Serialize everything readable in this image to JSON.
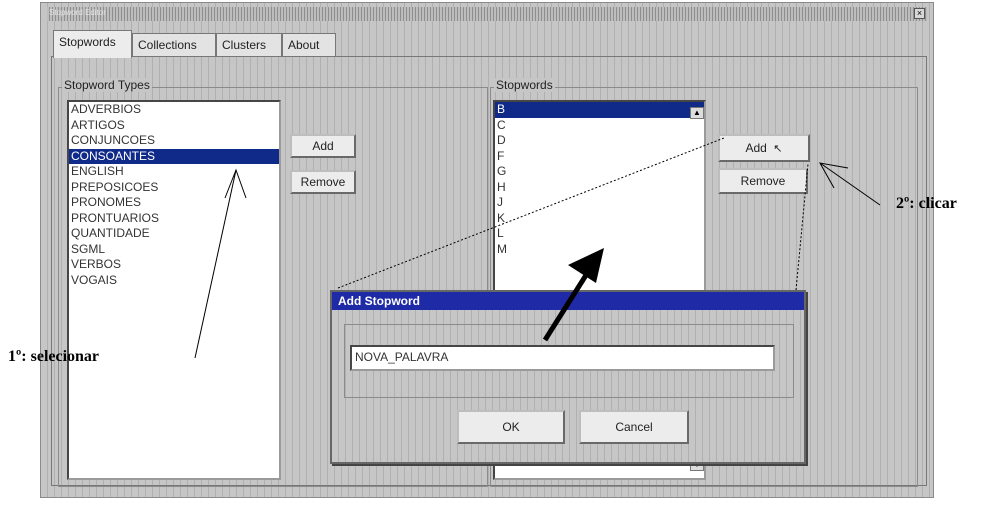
{
  "window": {
    "title": "Stopword Editor"
  },
  "tabs": [
    {
      "label": "Stopwords"
    },
    {
      "label": "Collections"
    },
    {
      "label": "Clusters"
    },
    {
      "label": "About"
    }
  ],
  "stopword_types": {
    "title": "Stopword Types",
    "items": [
      "ADVERBIOS",
      "ARTIGOS",
      "CONJUNCOES",
      "CONSOANTES",
      "ENGLISH",
      "PREPOSICOES",
      "PRONOMES",
      "PRONTUARIOS",
      "QUANTIDADE",
      "SGML",
      "VERBOS",
      "VOGAIS"
    ],
    "selected": "CONSOANTES",
    "add_label": "Add",
    "remove_label": "Remove"
  },
  "stopwords": {
    "title": "Stopwords",
    "items": [
      "B",
      "C",
      "D",
      "F",
      "G",
      "H",
      "J",
      "K",
      "L",
      "M"
    ],
    "selected": "B",
    "add_label": "Add",
    "remove_label": "Remove"
  },
  "dialog": {
    "title": "Add Stopword",
    "input_value": "NOVA_PALAVRA",
    "ok_label": "OK",
    "cancel_label": "Cancel"
  },
  "annotations": {
    "step1": "1º: selecionar",
    "step2": "2º: clicar"
  },
  "colors": {
    "selection": "#102a8a",
    "dialog_title": "#1f2aa6",
    "window_bg": "#c6c6c6"
  }
}
